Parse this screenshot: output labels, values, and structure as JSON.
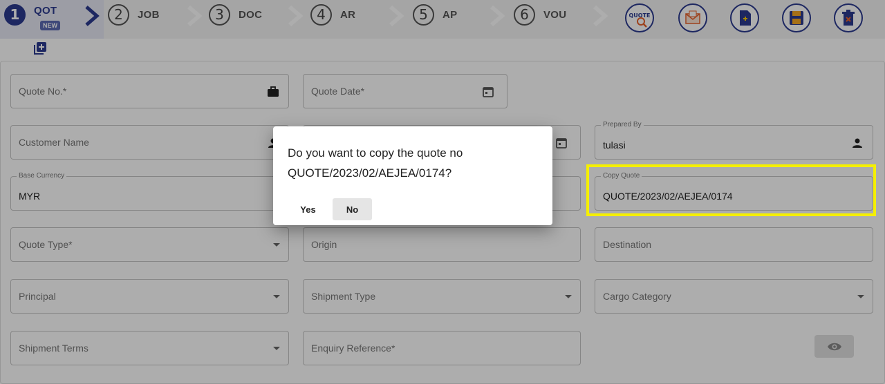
{
  "stepper": {
    "steps": [
      {
        "num": "1",
        "label": "QOT"
      },
      {
        "num": "2",
        "label": "JOB"
      },
      {
        "num": "3",
        "label": "DOC"
      },
      {
        "num": "4",
        "label": "AR"
      },
      {
        "num": "5",
        "label": "AP"
      },
      {
        "num": "6",
        "label": "VOU"
      }
    ],
    "badge": "NEW"
  },
  "toolbar": {
    "quote_icon_text": "QUOTE",
    "tools": [
      "quote-search-icon",
      "email-quote-icon",
      "new-document-icon",
      "save-icon",
      "delete-icon"
    ]
  },
  "form": {
    "quote_no": {
      "placeholder": "Quote No.*"
    },
    "quote_date": {
      "placeholder": "Quote Date*"
    },
    "customer_name": {
      "placeholder": "Customer Name"
    },
    "prepared_by": {
      "label": "Prepared By",
      "value": "tulasi"
    },
    "base_currency": {
      "label": "Base Currency",
      "value": "MYR"
    },
    "copy_quote": {
      "label": "Copy Quote",
      "value": "QUOTE/2023/02/AEJEA/0174"
    },
    "quote_type": {
      "placeholder": "Quote Type*"
    },
    "origin": {
      "placeholder": "Origin"
    },
    "destination": {
      "placeholder": "Destination"
    },
    "principal": {
      "placeholder": "Principal"
    },
    "shipment_type": {
      "placeholder": "Shipment Type"
    },
    "cargo_category": {
      "placeholder": "Cargo Category"
    },
    "shipment_terms": {
      "placeholder": "Shipment Terms"
    },
    "enquiry_reference": {
      "placeholder": "Enquiry Reference*"
    }
  },
  "dialog": {
    "message_line1": "Do you want to copy the quote no",
    "message_line2": "QUOTE/2023/02/AEJEA/0174?",
    "yes_label": "Yes",
    "no_label": "No"
  },
  "colors": {
    "accent": "#2b3a8f",
    "highlight": "#f5ef00",
    "overlay": "rgba(0,0,0,0.32)"
  }
}
